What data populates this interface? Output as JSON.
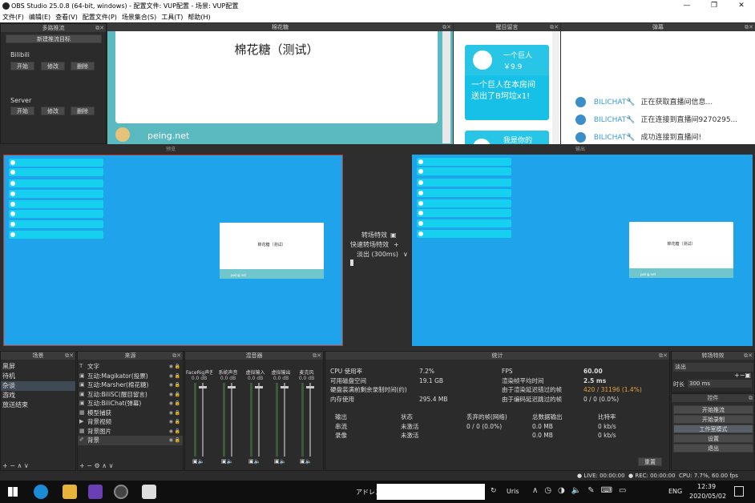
{
  "window": {
    "title": "OBS Studio 25.0.8 (64-bit, windows) - 配置文件: VUP配置 - 场景: VUP配置",
    "controls": [
      "—",
      "❐",
      "✕"
    ]
  },
  "menu": [
    "文件(F)",
    "编辑(E)",
    "查看(V)",
    "配置文件(P)",
    "场景集合(S)",
    "工具(T)",
    "帮助(H)"
  ],
  "stream_targets": {
    "header": "多路推流",
    "new_button": "新建推流目标",
    "groups": [
      {
        "name": "Bilibili",
        "buttons": [
          "开始",
          "修改",
          "删除"
        ]
      },
      {
        "name": "Server",
        "buttons": [
          "开始",
          "修改",
          "删除"
        ]
      }
    ]
  },
  "mianhuatang": {
    "header": "棉花糖",
    "title": "棉花糖（测试）",
    "site": "peing.net"
  },
  "danmaku": {
    "header": "醒目留言",
    "card1_user": "一个巨人",
    "card1_price": "￥9.9",
    "card1_msg": "一个巨人在本房间送出了B坷垃x1!",
    "card2_user": "我是你的"
  },
  "bilichat": {
    "header": "弹幕",
    "rows": [
      {
        "name": "BILICHAT🔧",
        "msg": "正在获取直播间信息..."
      },
      {
        "name": "BILICHAT🔧",
        "msg": "正在连接到直播间9270295..."
      },
      {
        "name": "BILICHAT🔧",
        "msg": "成功连接到直播间!"
      }
    ]
  },
  "preview": {
    "label": "预览",
    "card_title": "棉花糖（测试）",
    "card_foot": "peing.net"
  },
  "program": {
    "label": "输出",
    "card_title": "棉花糖（测试）",
    "card_foot": "peing.net"
  },
  "transition_center": {
    "row1": "转场特效",
    "row2": "快速转场特效",
    "row3": "淡出 (300ms)"
  },
  "scenes": {
    "header": "场景",
    "items": [
      "黑屏",
      "待机",
      "杂谈",
      "游戏",
      "放送结束"
    ],
    "selected": 2,
    "footer": "+ −  ∧ ∨"
  },
  "sources": {
    "header": "来源",
    "items": [
      {
        "icon": "T",
        "label": "文字"
      },
      {
        "icon": "▣",
        "label": "互动:Magikator(投票)"
      },
      {
        "icon": "▣",
        "label": "互动:Marsher(棉花糖)"
      },
      {
        "icon": "▣",
        "label": "互动:BiliSC(醒目留言)"
      },
      {
        "icon": "▣",
        "label": "互动:BiliChat(弹幕)"
      },
      {
        "icon": "▦",
        "label": "模型捕获"
      },
      {
        "icon": "▶",
        "label": "背景视频"
      },
      {
        "icon": "▦",
        "label": "背景图片"
      },
      {
        "icon": "✐",
        "label": "背景"
      }
    ],
    "footer": "+ − ⚙ ∧ ∨"
  },
  "mixer": {
    "header": "混音器",
    "channels": [
      {
        "name": "FaceRig声音",
        "db": "0.0 dB"
      },
      {
        "name": "系统声音",
        "db": "0.0 dB"
      },
      {
        "name": "虚拟输入",
        "db": "0.0 dB"
      },
      {
        "name": "虚拟输出",
        "db": "0.0 dB"
      },
      {
        "name": "麦克风",
        "db": "0.0 dB"
      }
    ]
  },
  "stats": {
    "header": "统计",
    "left": [
      {
        "k": "CPU 使用率",
        "v": "7.2%"
      },
      {
        "k": "可用磁盘空间",
        "v": "19.1 GB"
      },
      {
        "k": "硬盘装满前剩余录制时间(约)",
        "v": ""
      },
      {
        "k": "内存使用",
        "v": "295.4 MB"
      }
    ],
    "right": [
      {
        "k": "FPS",
        "v": "60.00"
      },
      {
        "k": "渲染帧平均时间",
        "v": "2.5 ms"
      },
      {
        "k": "由于渲染延迟错过的帧",
        "v": "420 / 31196 (1.4%)"
      },
      {
        "k": "由于编码延迟跳过的帧",
        "v": "0 / 0 (0.0%)"
      }
    ],
    "table_headers": [
      "输出",
      "状态",
      "丢弃的帧(网络)",
      "总数据输出",
      "比特率"
    ],
    "table_rows": [
      [
        "串流",
        "未激活",
        "0 / 0 (0.0%)",
        "0.0 MB",
        "0 kb/s"
      ],
      [
        "录像",
        "未激活",
        "",
        "0.0 MB",
        "0 kb/s"
      ]
    ],
    "reset": "重置"
  },
  "transitions": {
    "header": "转场特效",
    "current": "淡出",
    "duration_label": "时长",
    "duration": "300 ms"
  },
  "controls": {
    "header": "控件",
    "buttons": [
      "开始推流",
      "开始录制",
      "工作室模式",
      "设置",
      "退出"
    ],
    "active": 2
  },
  "statusbar": {
    "live": "LIVE: 00:00:00",
    "rec": "REC: 00:00:00",
    "cpu": "CPU: 7.7%, 60.00 fps"
  },
  "taskbar": {
    "address_label": "アドレス",
    "user": "Uris",
    "lang": "ENG",
    "time": "12:39",
    "date": "2020/05/02"
  },
  "colors": {
    "accent_blue": "#1fa3ea",
    "cyan": "#16d0f0",
    "teal": "#6fc6cd",
    "obs_bg": "#2b2b2b"
  }
}
